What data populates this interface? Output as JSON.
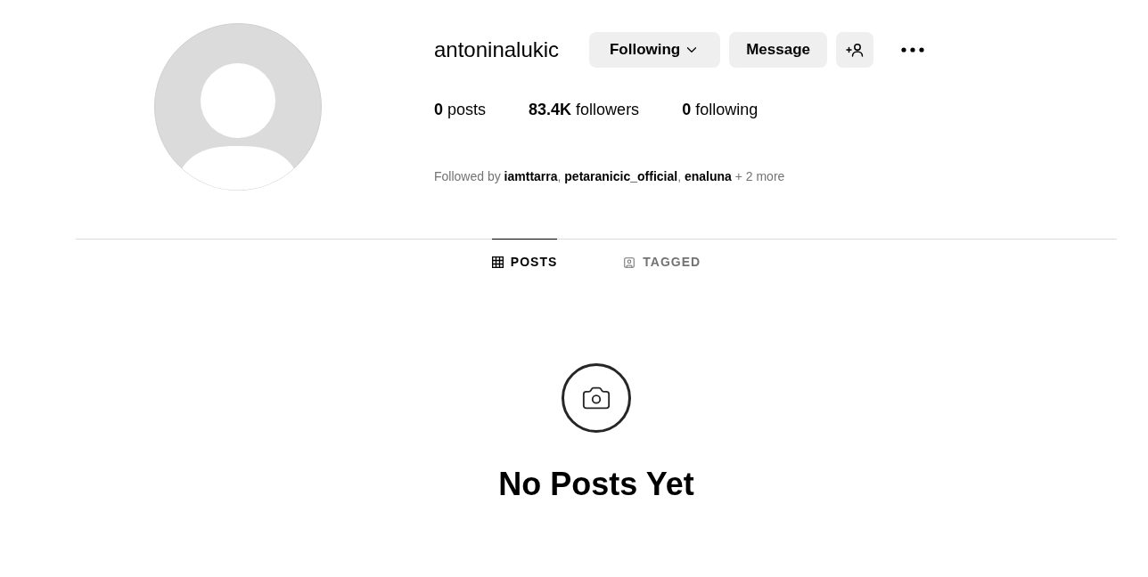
{
  "profile": {
    "username": "antoninalukic"
  },
  "actions": [
    {
      "kind": "dropdown",
      "label": "Following"
    },
    {
      "kind": "text",
      "label": "Message"
    },
    {
      "kind": "add-person"
    },
    {
      "kind": "more"
    }
  ],
  "stats": [
    "**0** posts",
    "**83.4K** followers",
    "**0** following"
  ],
  "followed_by": "Followed by **iamttarra**, **petaranicic_official**, **enaluna** + 2 more",
  "tabs": [
    {
      "kind": "grid",
      "label": "POSTS",
      "selected": true
    },
    {
      "kind": "tagged",
      "label": "TAGGED",
      "selected": false
    }
  ],
  "empty_state": {
    "title": "No Posts Yet"
  }
}
